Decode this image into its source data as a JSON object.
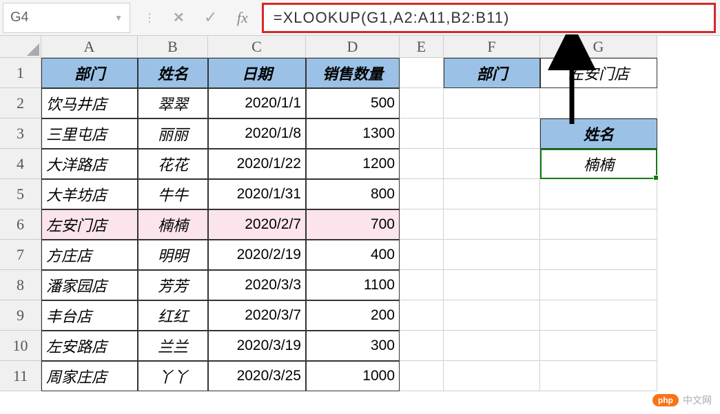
{
  "nameBox": "G4",
  "formula": "=XLOOKUP(G1,A2:A11,B2:B11)",
  "columns": [
    "A",
    "B",
    "C",
    "D",
    "E",
    "F",
    "G"
  ],
  "rows": [
    "1",
    "2",
    "3",
    "4",
    "5",
    "6",
    "7",
    "8",
    "9",
    "10",
    "11"
  ],
  "headers": {
    "A": "部门",
    "B": "姓名",
    "C": "日期",
    "D": "销售数量"
  },
  "data": [
    {
      "dept": "饮马井店",
      "name": "翠翠",
      "date": "2020/1/1",
      "qty": "500"
    },
    {
      "dept": "三里屯店",
      "name": "丽丽",
      "date": "2020/1/8",
      "qty": "1300"
    },
    {
      "dept": "大洋路店",
      "name": "花花",
      "date": "2020/1/22",
      "qty": "1200"
    },
    {
      "dept": "大羊坊店",
      "name": "牛牛",
      "date": "2020/1/31",
      "qty": "800"
    },
    {
      "dept": "左安门店",
      "name": "楠楠",
      "date": "2020/2/7",
      "qty": "700"
    },
    {
      "dept": "方庄店",
      "name": "明明",
      "date": "2020/2/19",
      "qty": "400"
    },
    {
      "dept": "潘家园店",
      "name": "芳芳",
      "date": "2020/3/3",
      "qty": "1100"
    },
    {
      "dept": "丰台店",
      "name": "红红",
      "date": "2020/3/7",
      "qty": "200"
    },
    {
      "dept": "左安路店",
      "name": "兰兰",
      "date": "2020/3/19",
      "qty": "300"
    },
    {
      "dept": "周家庄店",
      "name": "丫丫",
      "date": "2020/3/25",
      "qty": "1000"
    }
  ],
  "lookup": {
    "f1_label": "部门",
    "g1_value": "左安门店",
    "g3_label": "姓名",
    "g4_value": "楠楠"
  },
  "watermark": {
    "badge": "php",
    "text": "中文网"
  }
}
